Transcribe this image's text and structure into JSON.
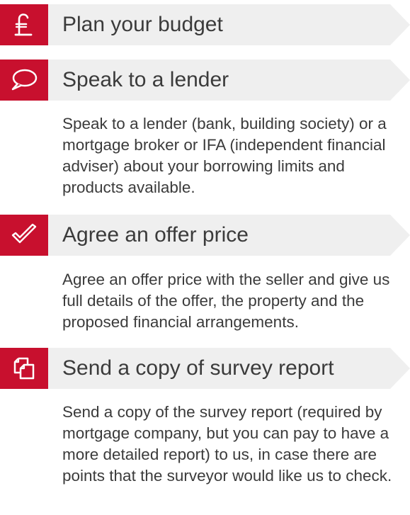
{
  "accent_color": "#c8102e",
  "header_bg_color": "#efefef",
  "steps": [
    {
      "icon": "pound-icon",
      "title": "Plan your budget",
      "description": ""
    },
    {
      "icon": "speech-bubble-icon",
      "title": "Speak to a lender",
      "description": "Speak to a lender (bank, building society) or a mortgage broker or IFA (independent financial adviser) about your borrowing limits and products available."
    },
    {
      "icon": "checkmark-icon",
      "title": "Agree an offer price",
      "description": "Agree an offer price with the seller and give us full details of the offer, the property and the proposed financial arrangements."
    },
    {
      "icon": "copy-documents-icon",
      "title": "Send a copy of survey report",
      "description": "Send a copy of the survey report (required by mortgage company, but you can pay to have a more detailed report) to us, in case there are points that the surveyor would like us to check."
    }
  ]
}
